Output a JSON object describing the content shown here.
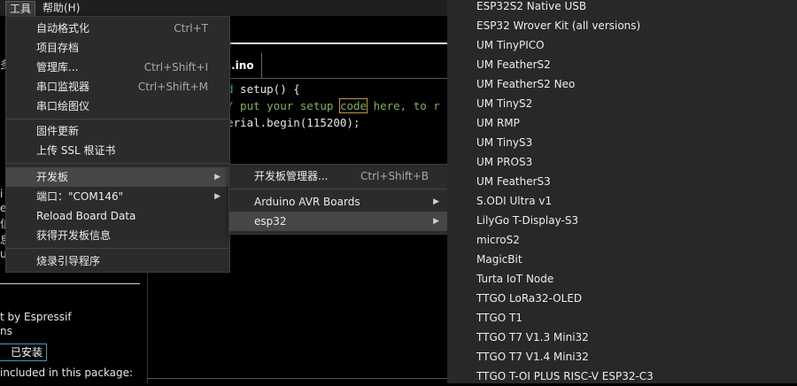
{
  "menubar": {
    "tools": "工具",
    "help": "帮助(H)"
  },
  "left_panel": {
    "fragments": [
      "多",
      "i",
      "e",
      "信",
      "息",
      "u"
    ],
    "desc1": "t by Espressif",
    "desc2": "ns",
    "installed": "已安装",
    "included": "included in this package:"
  },
  "editor": {
    "tab_label": "a.ino",
    "line1_kw": "d",
    "line1_rest": " setup() {",
    "line2_a": "/ put your setup ",
    "line2_hl": "code",
    "line2_b": " here, to r",
    "line3": "erial.begin(115200);"
  },
  "tools_menu": {
    "items": [
      {
        "label": "自动格式化",
        "shortcut": "Ctrl+T"
      },
      {
        "label": "项目存档",
        "shortcut": ""
      },
      {
        "label": "管理库...",
        "shortcut": "Ctrl+Shift+I"
      },
      {
        "label": "串口监视器",
        "shortcut": "Ctrl+Shift+M"
      },
      {
        "label": "串口绘图仪",
        "shortcut": ""
      },
      {
        "label": "固件更新",
        "shortcut": ""
      },
      {
        "label": "上传 SSL 根证书",
        "shortcut": ""
      },
      {
        "label": "开发板",
        "shortcut": ""
      },
      {
        "label": "端口：\"COM146\"",
        "shortcut": ""
      },
      {
        "label": "Reload Board Data",
        "shortcut": ""
      },
      {
        "label": "获得开发板信息",
        "shortcut": ""
      },
      {
        "label": "烧录引导程序",
        "shortcut": ""
      }
    ]
  },
  "board_submenu": {
    "items": [
      {
        "label": "开发板管理器...",
        "shortcut": "Ctrl+Shift+B"
      },
      {
        "label": "Arduino AVR Boards",
        "shortcut": ""
      },
      {
        "label": "esp32",
        "shortcut": ""
      }
    ]
  },
  "esp32_boards": [
    "ESP32S2 Native USB",
    "ESP32 Wrover Kit (all versions)",
    "UM TinyPICO",
    "UM FeatherS2",
    "UM FeatherS2 Neo",
    "UM TinyS2",
    "UM RMP",
    "UM TinyS3",
    "UM PROS3",
    "UM FeatherS3",
    "S.ODI Ultra v1",
    "LilyGo T-Display-S3",
    "microS2",
    "MagicBit",
    "Turta IoT Node",
    "TTGO LoRa32-OLED",
    "TTGO T1",
    "TTGO T7 V1.3 Mini32",
    "TTGO T7 V1.4 Mini32",
    "TTGO T-OI PLUS RISC-V ESP32-C3"
  ],
  "colors": {
    "accent_teal": "#2ec4c4",
    "comment_green": "#7fb24e",
    "highlight_border": "#c49b28"
  },
  "icons": {
    "submenu_arrow": "triangle-right-icon"
  }
}
